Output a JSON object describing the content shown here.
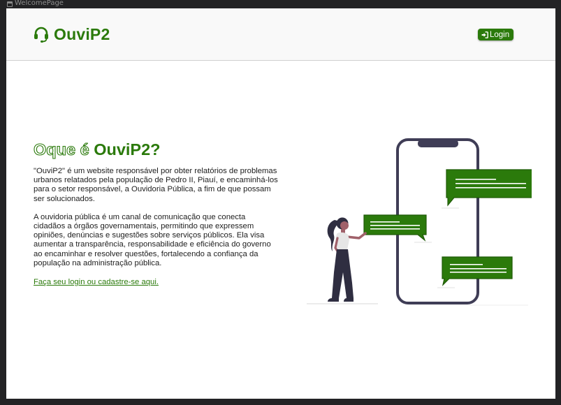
{
  "window": {
    "title": "WelcomePage",
    "icon": "window-icon"
  },
  "header": {
    "logo_text": "OuviP2",
    "logo_icon": "headset-icon",
    "login_label": "Login",
    "login_icon": "sign-in-icon"
  },
  "main": {
    "title_part1": "Oque é",
    "title_part2": "OuviP2?",
    "paragraph1": "\"OuviP2\" é um website responsável por obter relatórios de problemas urbanos relatados pela população de Pedro II, Piauí, e encaminhá-los para o setor responsável, a Ouvidoria Pública, a fim de que possam ser solucionados.",
    "paragraph2": "A ouvidoria pública é um canal de comunicação que conecta cidadãos a órgãos governamentais, permitindo que expressem opiniões, denúncias e sugestões sobre serviços públicos. Ela visa aumentar a transparência, responsabilidade e eficiência do governo ao encaminhar e resolver questões, fortalecendo a confiança da população na administração pública.",
    "cta_link": "Faça seu login ou cadastre-se aqui.",
    "illustration": "woman-phone-chat-illustration"
  },
  "colors": {
    "brand_green": "#2b7a0b",
    "header_bg": "#f9f9f9",
    "phone_frame": "#3f3d56",
    "chrome_bg": "#232325"
  }
}
